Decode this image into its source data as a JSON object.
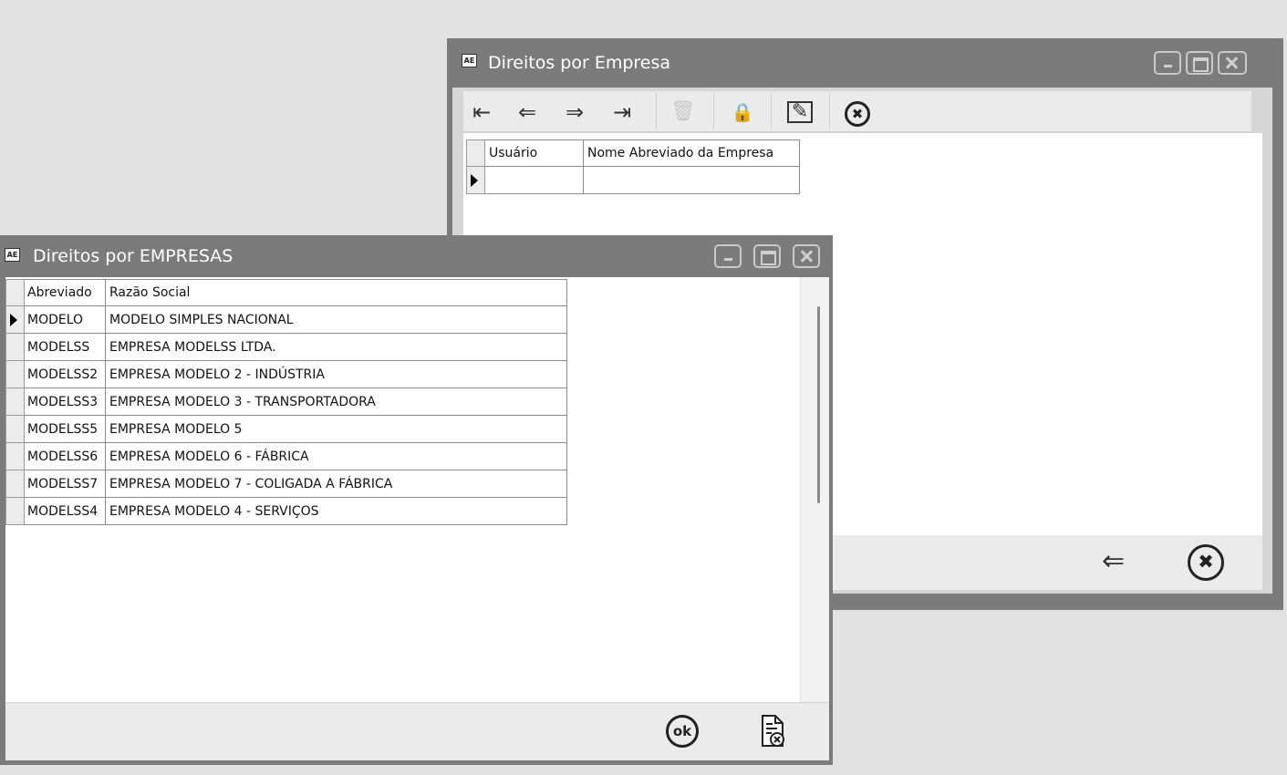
{
  "window_back": {
    "icon_text": "AE",
    "title": "Direitos por Empresa",
    "toolbar": {
      "first_icon": "⇤",
      "prev_icon": "⇐",
      "next_icon": "⇒",
      "last_icon": "⇥",
      "delete_icon": "🗑",
      "lock_icon": "🔒",
      "edit_icon": "✎",
      "cancel_icon": "✖"
    },
    "grid": {
      "columns": [
        "Usuário",
        "Nome Abreviado da Empresa"
      ],
      "rows": [
        [
          "",
          ""
        ]
      ]
    },
    "footer": {
      "back_icon": "⇐",
      "close_icon": "✖"
    }
  },
  "window_front": {
    "icon_text": "AE",
    "title": "Direitos por EMPRESAS",
    "grid": {
      "columns": [
        "Abreviado",
        "Razão Social"
      ],
      "rows": [
        [
          "MODELO",
          "MODELO SIMPLES NACIONAL"
        ],
        [
          "MODELSS",
          "EMPRESA MODELSS LTDA."
        ],
        [
          "MODELSS2",
          "EMPRESA MODELO 2 - INDÚSTRIA"
        ],
        [
          "MODELSS3",
          "EMPRESA MODELO 3 - TRANSPORTADORA"
        ],
        [
          "MODELSS5",
          "EMPRESA MODELO 5"
        ],
        [
          "MODELSS6",
          "EMPRESA MODELO 6 - FÁBRICA"
        ],
        [
          "MODELSS7",
          "EMPRESA MODELO 7 - COLIGADA A FÁBRICA"
        ],
        [
          "MODELSS4",
          "EMPRESA MODELO 4 - SERVIÇOS"
        ]
      ]
    },
    "footer": {
      "ok_label": "ok"
    }
  }
}
